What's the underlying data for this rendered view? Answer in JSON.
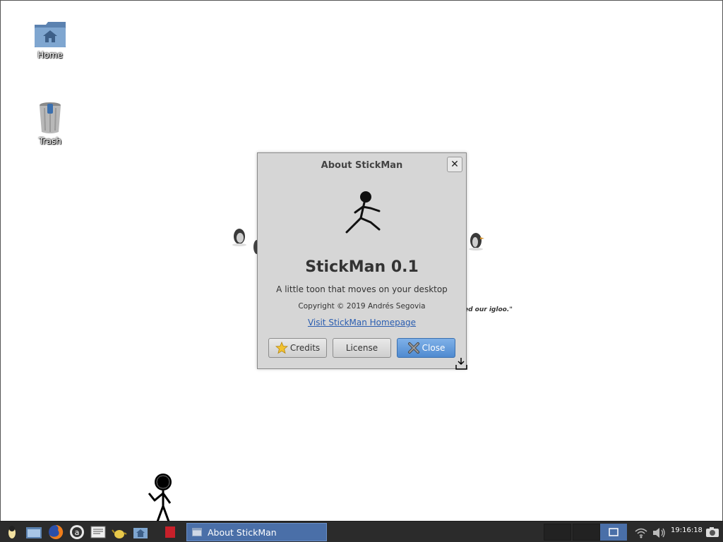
{
  "desktop": {
    "icons": [
      {
        "label": "Home"
      },
      {
        "label": "Trash"
      }
    ],
    "wallpaper_text": "ed our igloo.\""
  },
  "dialog": {
    "title": "About StickMan",
    "app_name": "StickMan 0.1",
    "description": "A little toon that moves on your desktop",
    "copyright": "Copyright © 2019 Andrés Segovia",
    "link": "Visit StickMan Homepage",
    "buttons": {
      "credits": "Credits",
      "license": "License",
      "close": "Close"
    }
  },
  "taskbar": {
    "active_task": "About StickMan",
    "clock": "19:16:18"
  },
  "colors": {
    "dialog_bg": "#d6d6d6",
    "close_button": "#4f8ad0",
    "link": "#2a5db0",
    "taskbar_bg": "#2b2b2b",
    "active_task_bg": "#4a6fa8"
  }
}
